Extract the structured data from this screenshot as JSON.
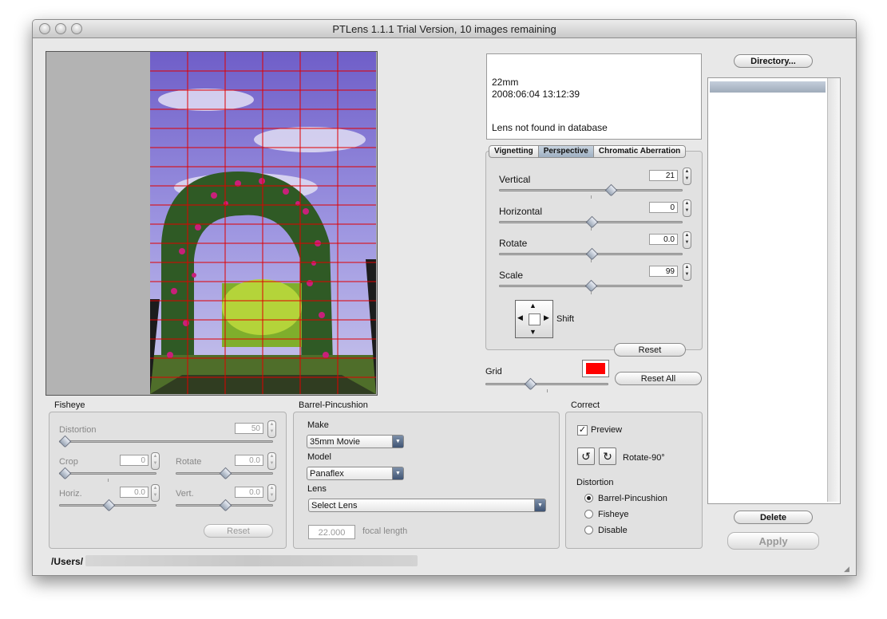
{
  "window": {
    "title": "PTLens 1.1.1 Trial Version, 10 images remaining"
  },
  "info": {
    "focal": "22mm",
    "datetime": "2008:06:04 13:12:39",
    "lens_status": "Lens not found in database"
  },
  "tabs": [
    {
      "label": "Vignetting",
      "selected": false
    },
    {
      "label": "Perspective",
      "selected": true
    },
    {
      "label": "Chromatic Aberration",
      "selected": false
    }
  ],
  "perspective": {
    "vertical": {
      "label": "Vertical",
      "value": "21"
    },
    "horizontal": {
      "label": "Horizontal",
      "value": "0"
    },
    "rotate": {
      "label": "Rotate",
      "value": "0.0"
    },
    "scale": {
      "label": "Scale",
      "value": "99"
    },
    "shift_label": "Shift",
    "reset_label": "Reset"
  },
  "grid": {
    "label": "Grid",
    "color": "#ff0000",
    "reset_all_label": "Reset All"
  },
  "fisheye": {
    "title": "Fisheye",
    "distortion": {
      "label": "Distortion",
      "value": "50"
    },
    "crop": {
      "label": "Crop",
      "value": "0"
    },
    "rotate": {
      "label": "Rotate",
      "value": "0.0"
    },
    "horiz": {
      "label": "Horiz.",
      "value": "0.0"
    },
    "vert": {
      "label": "Vert.",
      "value": "0.0"
    },
    "reset_label": "Reset"
  },
  "barrel": {
    "title": "Barrel-Pincushion",
    "make_label": "Make",
    "make_value": "35mm Movie",
    "model_label": "Model",
    "model_value": "Panaflex",
    "lens_label": "Lens",
    "lens_value": "Select Lens",
    "focal_value": "22.000",
    "focal_label": "focal length"
  },
  "correct": {
    "title": "Correct",
    "preview_label": "Preview",
    "preview_checked": true,
    "rotate_label": "Rotate-90°",
    "distortion_label": "Distortion",
    "options": [
      {
        "label": "Barrel-Pincushion",
        "selected": true
      },
      {
        "label": "Fisheye",
        "selected": false
      },
      {
        "label": "Disable",
        "selected": false
      }
    ]
  },
  "sidebar": {
    "directory_label": "Directory...",
    "delete_label": "Delete",
    "apply_label": "Apply"
  },
  "path": "/Users/"
}
